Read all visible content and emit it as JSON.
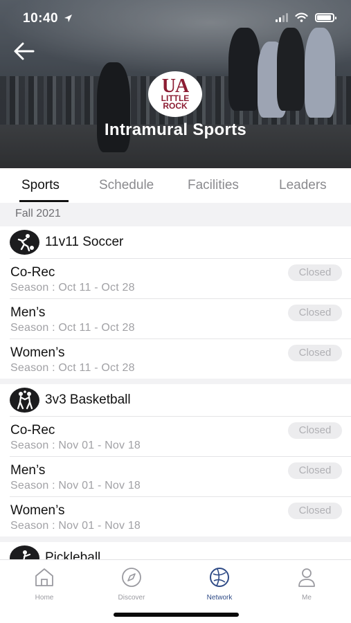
{
  "status_bar": {
    "time": "10:40"
  },
  "header": {
    "logo_line1": "UA",
    "logo_line2": "LITTLE",
    "logo_line3": "ROCK",
    "title": "Intramural Sports"
  },
  "tabs": [
    {
      "label": "Sports",
      "active": true
    },
    {
      "label": "Schedule",
      "active": false
    },
    {
      "label": "Facilities",
      "active": false
    },
    {
      "label": "Leaders",
      "active": false
    }
  ],
  "season_label": "Fall 2021",
  "sports": [
    {
      "name": "11v11 Soccer",
      "icon": "soccer-icon",
      "leagues": [
        {
          "name": "Co-Rec",
          "dates": "Season : Oct 11 - Oct 28",
          "status": "Closed"
        },
        {
          "name": "Men’s",
          "dates": "Season : Oct 11 - Oct 28",
          "status": "Closed"
        },
        {
          "name": "Women’s",
          "dates": "Season : Oct 11 - Oct 28",
          "status": "Closed"
        }
      ]
    },
    {
      "name": "3v3 Basketball",
      "icon": "basketball-icon",
      "leagues": [
        {
          "name": "Co-Rec",
          "dates": "Season : Nov 01 - Nov 18",
          "status": "Closed"
        },
        {
          "name": "Men’s",
          "dates": "Season : Nov 01 - Nov 18",
          "status": "Closed"
        },
        {
          "name": "Women’s",
          "dates": "Season : Nov 01 - Nov 18",
          "status": "Closed"
        }
      ]
    }
  ],
  "partial_sport": {
    "name": "Pickleball",
    "icon": "pickleball-icon"
  },
  "bottom_nav": [
    {
      "label": "Home",
      "icon": "home-icon",
      "active": false
    },
    {
      "label": "Discover",
      "icon": "compass-icon",
      "active": false
    },
    {
      "label": "Network",
      "icon": "network-icon",
      "active": true
    },
    {
      "label": "Me",
      "icon": "person-icon",
      "active": false
    }
  ],
  "colors": {
    "brand": "#8c1d33",
    "active_nav": "#2e4a86",
    "badge_bg": "#ececee",
    "badge_text": "#b0b0b4"
  }
}
